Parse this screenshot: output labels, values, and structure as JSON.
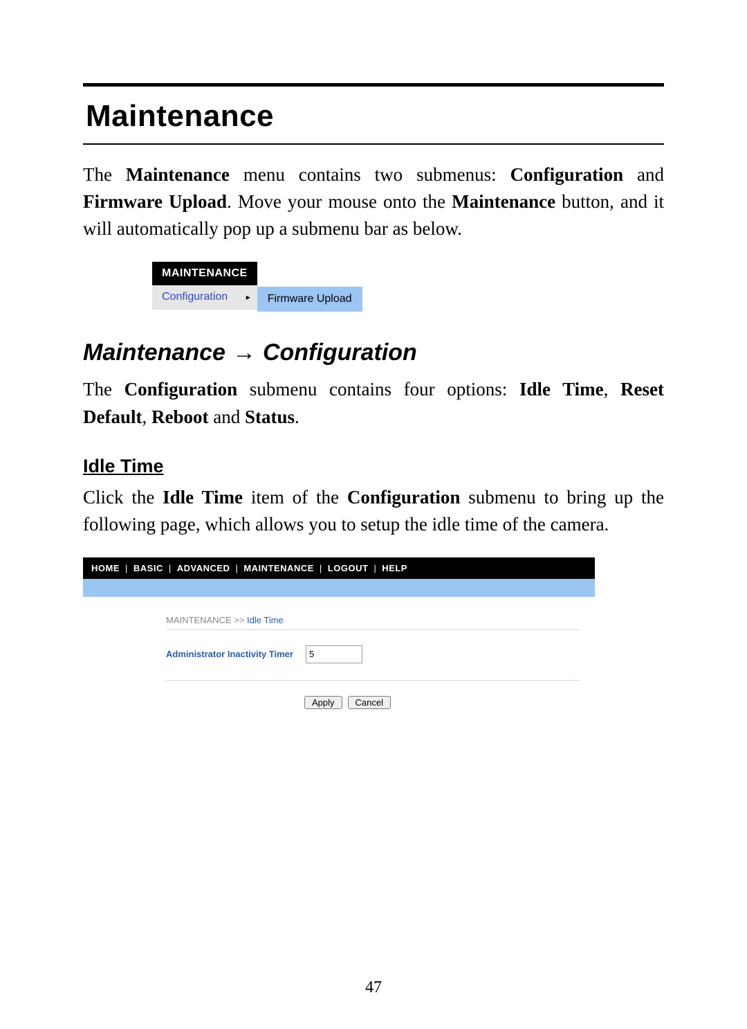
{
  "headings": {
    "main": "Maintenance",
    "sub_left": "Maintenance",
    "sub_arrow": "→",
    "sub_right": "Configuration",
    "idle": "Idle Time"
  },
  "para1": {
    "t1": "The ",
    "b1": "Maintenance",
    "t2": " menu contains two submenus: ",
    "b2": "Configuration",
    "t3": " and ",
    "b3": "Firmware Upload",
    "t4": ".  Move your mouse onto the ",
    "b4": "Maintenance",
    "t5": " button, and it will automatically pop up a submenu bar as below."
  },
  "submenu": {
    "header": "MAINTENANCE",
    "item1": "Configuration",
    "item1_arrow": "▸",
    "item2": "Firmware Upload"
  },
  "para2": {
    "t1": "The ",
    "b1": "Configuration",
    "t2": " submenu contains four options: ",
    "b2": "Idle Time",
    "t3": ", ",
    "b3": "Reset Default",
    "t4": ", ",
    "b4": "Reboot",
    "t5": " and ",
    "b5": "Status",
    "t6": "."
  },
  "para3": {
    "t1": "Click the ",
    "b1": "Idle Time",
    "t2": " item of the ",
    "b2": "Configuration",
    "t3": " submenu to bring up the following page, which allows you to setup the idle time of the camera."
  },
  "ui": {
    "nav": {
      "home": "HOME",
      "basic": "BASIC",
      "advanced": "ADVANCED",
      "maintenance": "MAINTENANCE",
      "logout": "LOGOUT",
      "help": "HELP",
      "sep": "|"
    },
    "breadcrumb_root": "MAINTENANCE >> ",
    "breadcrumb_current": "Idle Time",
    "form_label": "Administrator Inactivity Timer",
    "form_value": "5",
    "apply": "Apply",
    "cancel": "Cancel"
  },
  "page_number": "47"
}
